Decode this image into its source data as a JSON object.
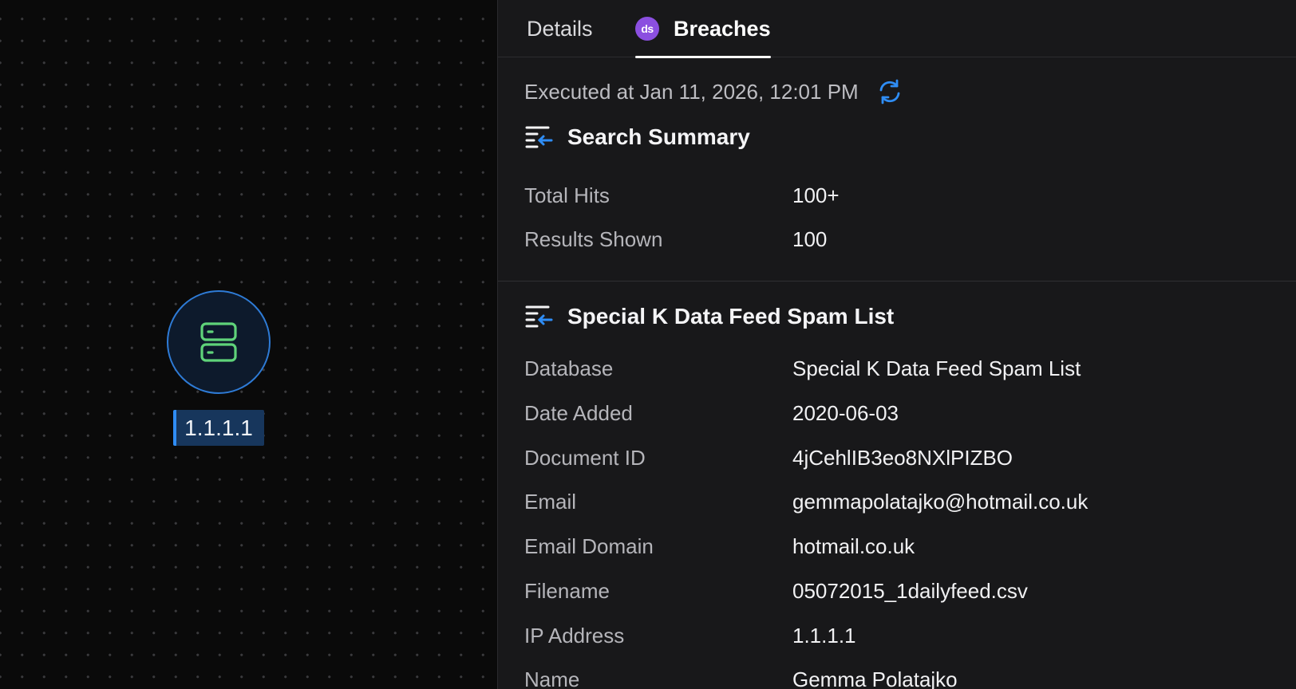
{
  "graph": {
    "node": {
      "label": "1.1.1.1",
      "icon": "server-icon"
    }
  },
  "tabs": [
    {
      "label": "Details",
      "active": false
    },
    {
      "label": "Breaches",
      "active": true,
      "badge": "ds"
    }
  ],
  "executed": {
    "text": "Executed at Jan 11, 2026, 12:01 PM"
  },
  "summary": {
    "title": "Search Summary",
    "rows": [
      {
        "key": "Total Hits",
        "value": "100+"
      },
      {
        "key": "Results Shown",
        "value": "100"
      }
    ]
  },
  "record": {
    "title": "Special K Data Feed Spam List",
    "rows": [
      {
        "key": "Database",
        "value": "Special K Data Feed Spam List"
      },
      {
        "key": "Date Added",
        "value": "2020-06-03"
      },
      {
        "key": "Document ID",
        "value": "4jCehlIB3eo8NXlPIZBO"
      },
      {
        "key": "Email",
        "value": "gemmapolatajko@hotmail.co.uk"
      },
      {
        "key": "Email Domain",
        "value": "hotmail.co.uk"
      },
      {
        "key": "Filename",
        "value": "05072015_1dailyfeed.csv"
      },
      {
        "key": "IP Address",
        "value": "1.1.1.1"
      },
      {
        "key": "Name",
        "value": "Gemma Polatajko"
      }
    ]
  },
  "colors": {
    "accent": "#2f8df5",
    "node_icon": "#5fd37a",
    "badge": "#8b4fe0",
    "panel_bg": "#18181a",
    "canvas_bg": "#0a0a0a"
  }
}
